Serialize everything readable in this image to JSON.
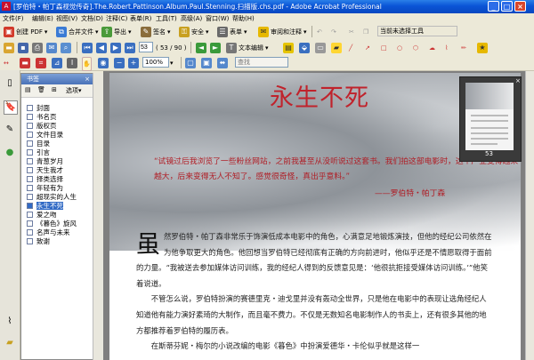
{
  "window": {
    "title": "[罗伯特・帕丁森视觉传奇].The.Robert.Pattinson.Album.Paul.Stenning.扫描版.chs.pdf - Adobe Acrobat Professional",
    "app_icon": "acrobat-icon",
    "colors": {
      "titlebar": "#0A54D6",
      "accent_red": "#C0232C"
    }
  },
  "menubar": {
    "items": [
      "文件(F)",
      "编辑(E)",
      "视图(V)",
      "文档(D)",
      "注释(C)",
      "表单(R)",
      "工具(T)",
      "高级(A)",
      "窗口(W)",
      "帮助(H)"
    ]
  },
  "toolbar1": {
    "create_pdf": "创建 PDF",
    "combine": "合并文件",
    "export": "导出",
    "sign": "签名",
    "secure": "安全",
    "forms": "表单",
    "review": "审阅和注释",
    "select_tool": "当前未选择工具"
  },
  "toolbar2": {
    "page_current": "53",
    "page_total": "( 53 / 90 )",
    "text_edit": "文本编辑"
  },
  "toolbar3": {
    "zoom": "100%",
    "search_placeholder": "查找"
  },
  "bookmarks": {
    "header": "书签",
    "options_label": "选项",
    "items": [
      "封面",
      "书名页",
      "版权页",
      "文件目录",
      "目录",
      "引言",
      "青葱岁月",
      "天生我才",
      "择类选择",
      "年轻有为",
      "超现实的人生",
      "永生不死",
      "爱之吻",
      "《暮色》旋风",
      "名声与未来",
      "致谢"
    ],
    "selected_index": 11
  },
  "page": {
    "title": "永生不死",
    "quote": "“试镜过后我浏览了一些粉丝网站，之前我甚至从没听说过这套书。我们拍这部电影时，这个产业变得越来越大，后来变得无人不知了。感觉很奇怪，真出乎意料。”",
    "attribution": "——罗伯特・帕丁森",
    "dropcap": "虽",
    "paragraph1": "然罗伯特・帕丁森非常乐于饰演低成本电影中的角色，心满意足地锻炼演技，但他的经纪公司依然在为他争取更大的角色。他回想当罗伯特已经彻底有正确的方向前进时，他似乎还是不情愿取得于面前的力量。“我被送去参加媒体访问训练，我的经纪人得到的反馈意见是：‘他很抗拒接受媒体访问训练。’”他笑着说道。",
    "paragraph2": "不管怎么说，罗伯特扮演的赛德里克・迪戈里并没有轰动全世界，只是他在电影中的表现让选角经纪人知道他有能力演好素琦的大制作，而且毫不费力。不仅是无数知名电影制作人的书卖上，还有很多其他的地方都推荐着罗伯特的履历表。",
    "paragraph3": "在斯蒂芬妮・梅尔的小说改编的电影《暮色》中扮演爱德华・卡伦似乎就是这样一"
  },
  "thumbnail": {
    "page_number": "53"
  }
}
